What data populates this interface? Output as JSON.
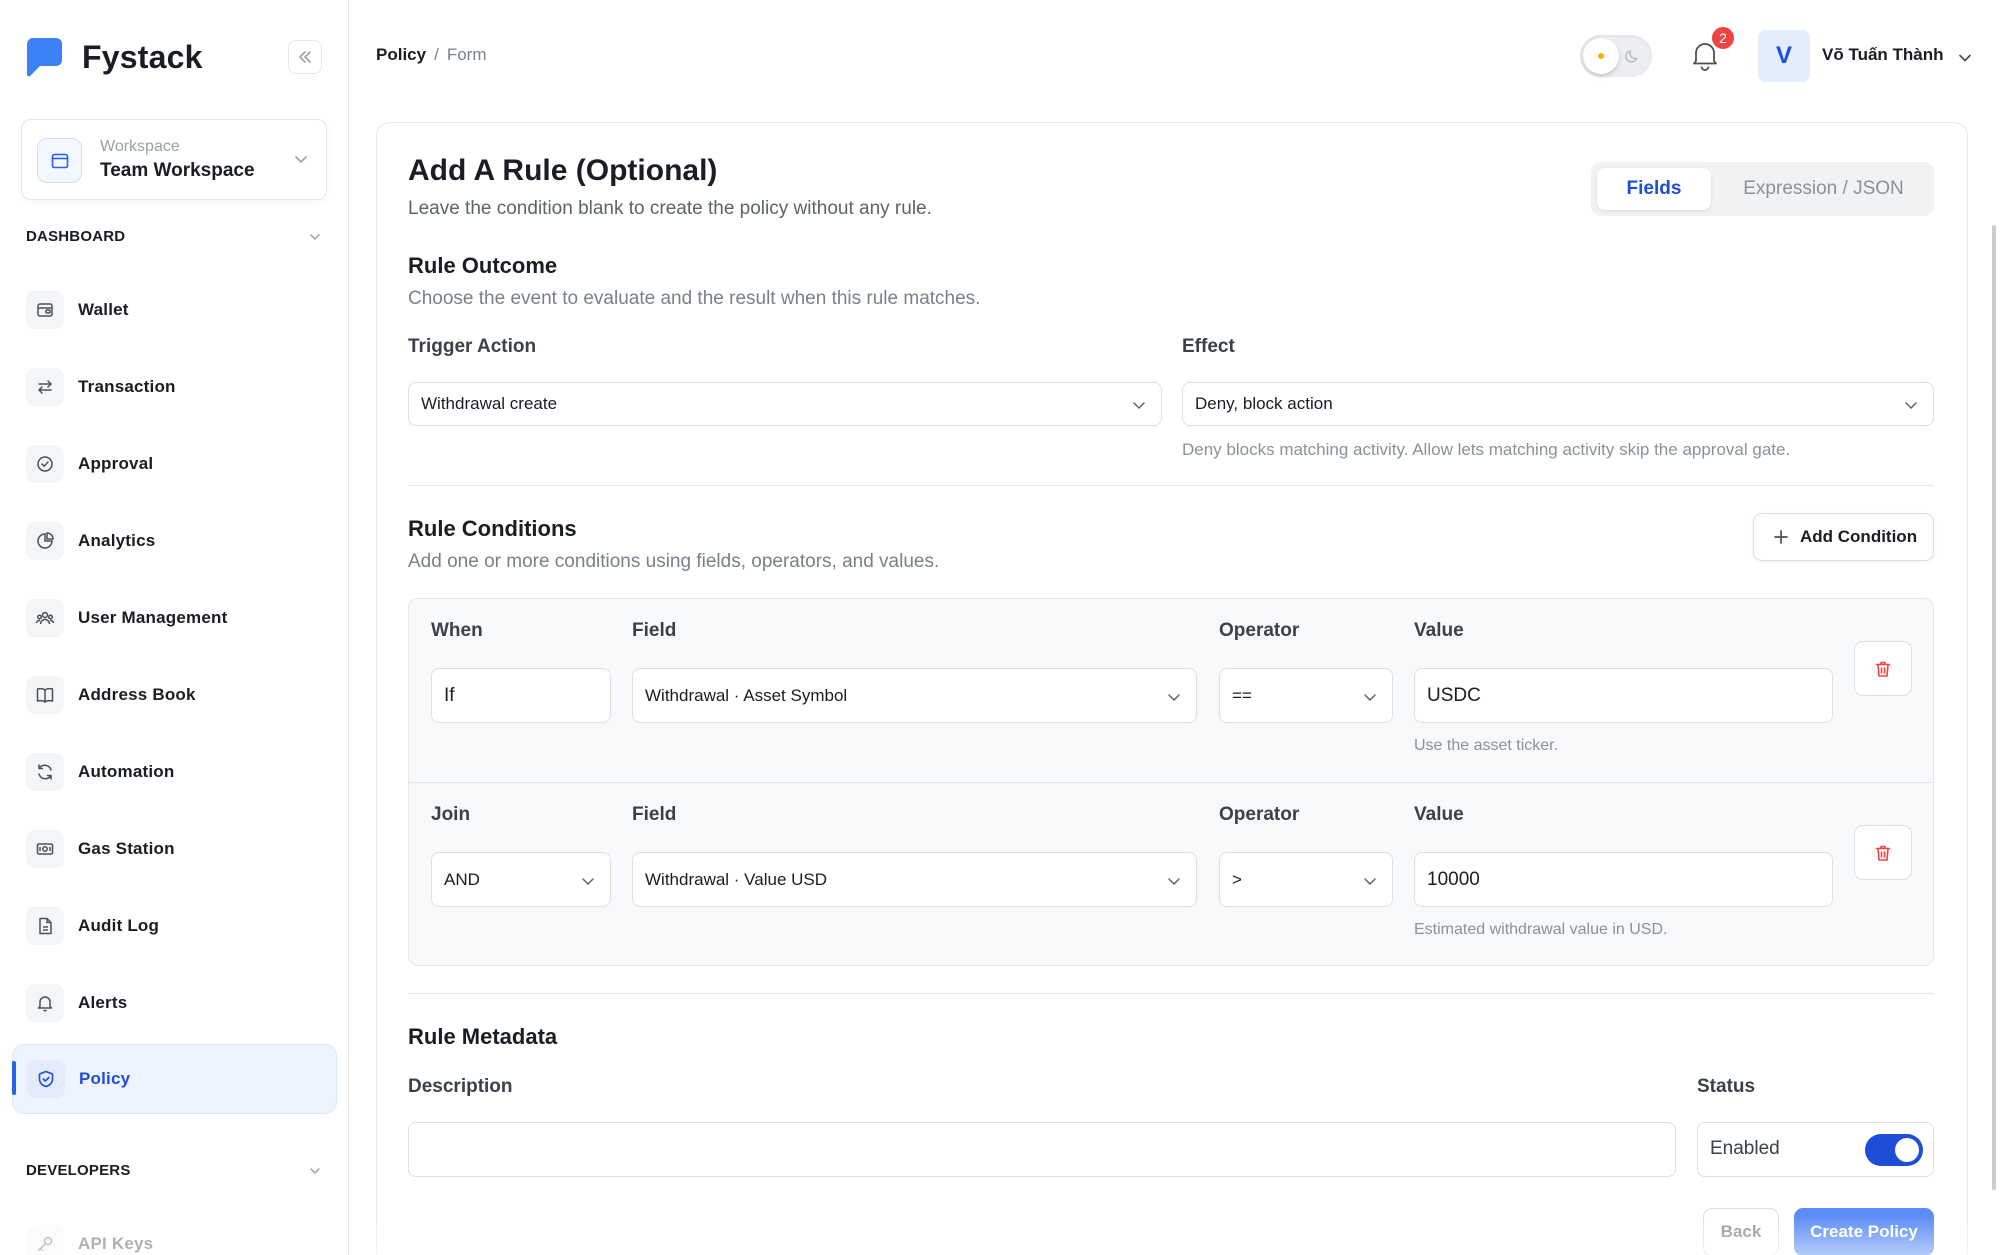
{
  "app": {
    "name": "Fystack"
  },
  "workspace": {
    "caption": "Workspace",
    "name": "Team Workspace"
  },
  "sidebar": {
    "section_dashboard": "DASHBOARD",
    "section_developers": "DEVELOPERS",
    "items": [
      {
        "label": "Wallet",
        "icon": "wallet-icon"
      },
      {
        "label": "Transaction",
        "icon": "arrows-exchange-icon"
      },
      {
        "label": "Approval",
        "icon": "check-circle-icon"
      },
      {
        "label": "Analytics",
        "icon": "pie-chart-icon"
      },
      {
        "label": "User Management",
        "icon": "users-icon"
      },
      {
        "label": "Address Book",
        "icon": "book-icon"
      },
      {
        "label": "Automation",
        "icon": "refresh-icon"
      },
      {
        "label": "Gas Station",
        "icon": "banknote-icon"
      },
      {
        "label": "Audit Log",
        "icon": "file-icon"
      },
      {
        "label": "Alerts",
        "icon": "bell-icon"
      },
      {
        "label": "Policy",
        "icon": "shield-icon",
        "active": true
      }
    ],
    "dev_items": [
      {
        "label": "API Keys",
        "icon": "key-icon"
      }
    ]
  },
  "breadcrumb": {
    "root": "Policy",
    "separator": "/",
    "current": "Form"
  },
  "header": {
    "notification_count": "2",
    "avatar_initial": "V",
    "user_name": "Võ Tuấn Thành"
  },
  "form": {
    "title": "Add A Rule (Optional)",
    "subtitle": "Leave the condition blank to create the policy without any rule.",
    "mode_tabs": {
      "fields": "Fields",
      "expression": "Expression / JSON",
      "selected": "Fields"
    },
    "outcome": {
      "title": "Rule Outcome",
      "subtitle": "Choose the event to evaluate and the result when this rule matches.",
      "trigger_label": "Trigger Action",
      "trigger_value": "Withdrawal create",
      "effect_label": "Effect",
      "effect_value": "Deny, block action",
      "effect_hint": "Deny blocks matching activity. Allow lets matching activity skip the approval gate."
    },
    "conditions": {
      "title": "Rule Conditions",
      "subtitle": "Add one or more conditions using fields, operators, and values.",
      "add_button": "Add Condition",
      "rows": [
        {
          "first_label": "When",
          "first_value": "If",
          "field_label": "Field",
          "field_value": "Withdrawal · Asset Symbol",
          "operator_label": "Operator",
          "operator_value": "==",
          "value_label": "Value",
          "value": "USDC",
          "hint": "Use the asset ticker."
        },
        {
          "first_label": "Join",
          "first_value": "AND",
          "field_label": "Field",
          "field_value": "Withdrawal · Value USD",
          "operator_label": "Operator",
          "operator_value": ">",
          "value_label": "Value",
          "value": "10000",
          "hint": "Estimated withdrawal value in USD."
        }
      ]
    },
    "metadata": {
      "title": "Rule Metadata",
      "description_label": "Description",
      "description_value": "",
      "status_label": "Status",
      "status_value": "Enabled",
      "status_enabled": true
    },
    "actions": {
      "back": "Back",
      "create": "Create Policy"
    }
  },
  "colors": {
    "accent": "#1e4ed8",
    "badge": "#ef4444",
    "logo": "#3b82f6",
    "delete": "#ef4444"
  }
}
